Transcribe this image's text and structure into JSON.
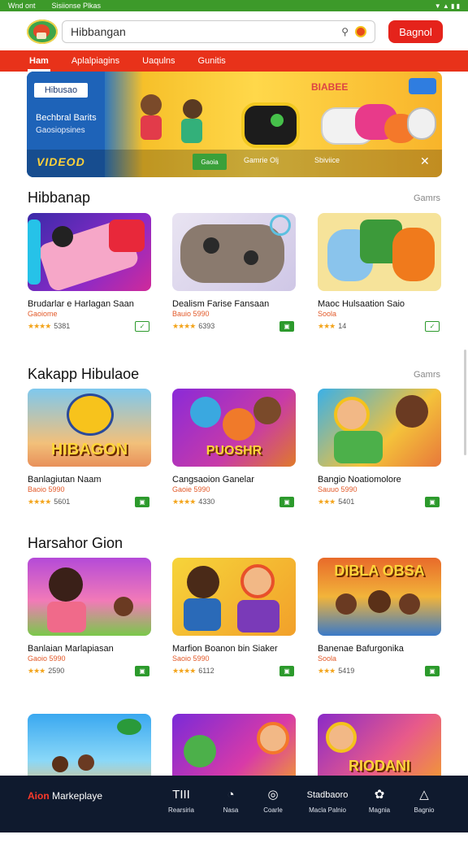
{
  "status_bar": {
    "left": "Wnd ont",
    "center": "Sisiionse Plkas",
    "right": "▼ ▲ ▮ ▮"
  },
  "header": {
    "search_value": "Hibbangan",
    "button_label": "Bagnol"
  },
  "nav": {
    "tabs": [
      "Ham",
      "Aplalpiagins",
      "Uaqulns",
      "Gunitis"
    ],
    "active": 0
  },
  "banner": {
    "badge": "Hibusao",
    "subtitle": "Bechbral Barits",
    "caption": "Gaosiopsines",
    "logo": "VIDEOD",
    "button": "Gaoia",
    "text1": "Gamrie Olj",
    "text2": "Sbiviice",
    "brand": "BIABEE"
  },
  "sections": [
    {
      "title": "Hibbanap",
      "link": "Gamrs",
      "cards": [
        {
          "title": "Brudarlar e Harlagan Saan",
          "sub": "Gaoiome",
          "rating": "5381",
          "stars": "★★★★",
          "badge": "✓",
          "badge_filled": false
        },
        {
          "title": "Dealism Farise Fansaan",
          "sub": "Bauio 5990",
          "rating": "6393",
          "stars": "★★★★",
          "badge": "▣",
          "badge_filled": true
        },
        {
          "title": "Maoc Hulsaation Saio",
          "sub": "Soola",
          "rating": "14",
          "stars": "★★★",
          "badge": "✓",
          "badge_filled": false
        }
      ]
    },
    {
      "title": "Kakapp Hibulaoe",
      "link": "Gamrs",
      "cards": [
        {
          "title": "Banlagiutan Naam",
          "sub": "Baoio 5990",
          "rating": "5601",
          "stars": "★★★★",
          "badge": "▣",
          "badge_filled": true
        },
        {
          "title": "Cangsaoion Ganelar",
          "sub": "Gaoie 5990",
          "rating": "4330",
          "stars": "★★★★",
          "badge": "▣",
          "badge_filled": true
        },
        {
          "title": "Bangio Noatiomolore",
          "sub": "Sauuo 5990",
          "rating": "5401",
          "stars": "★★★",
          "badge": "▣",
          "badge_filled": true
        }
      ]
    },
    {
      "title": "Harsahor Gion",
      "link": "",
      "cards": [
        {
          "title": "Banlaian Marlapiasan",
          "sub": "Gaoio 5990",
          "rating": "2590",
          "stars": "★★★",
          "badge": "▣",
          "badge_filled": true
        },
        {
          "title": "Marfion Boanon bin Siaker",
          "sub": "Saoio 5990",
          "rating": "6112",
          "stars": "★★★★",
          "badge": "▣",
          "badge_filled": true
        },
        {
          "title": "Banenae Bafurgonika",
          "sub": "Soola",
          "rating": "5419",
          "stars": "★★★",
          "badge": "▣",
          "badge_filled": true
        }
      ]
    }
  ],
  "thumb_labels": {
    "s1c0": "",
    "s2c0": "HIBAGON",
    "s2c1": "PUOSHR",
    "s3c2": "DIBLA OBSA",
    "s4c2": "RIODANI"
  },
  "bottom_bar": {
    "brand_red": "Aion",
    "brand_white": " Markeplaye",
    "items": [
      {
        "icon": "TIII",
        "label": "Rearsiria"
      },
      {
        "icon": "◔",
        "label": "Nasa"
      },
      {
        "icon": "◎",
        "label": "Coarle"
      },
      {
        "icon": "Stadbaoro",
        "label": "Macla Palnio"
      },
      {
        "icon": "✿",
        "label": "Magnia"
      },
      {
        "icon": "△",
        "label": "Bagnio"
      }
    ]
  },
  "colors": {
    "accent": "#e8321a",
    "status_bar": "#3d9a2a",
    "bottom_bar": "#0f1a2e",
    "install_badge": "#2c9a2c"
  }
}
